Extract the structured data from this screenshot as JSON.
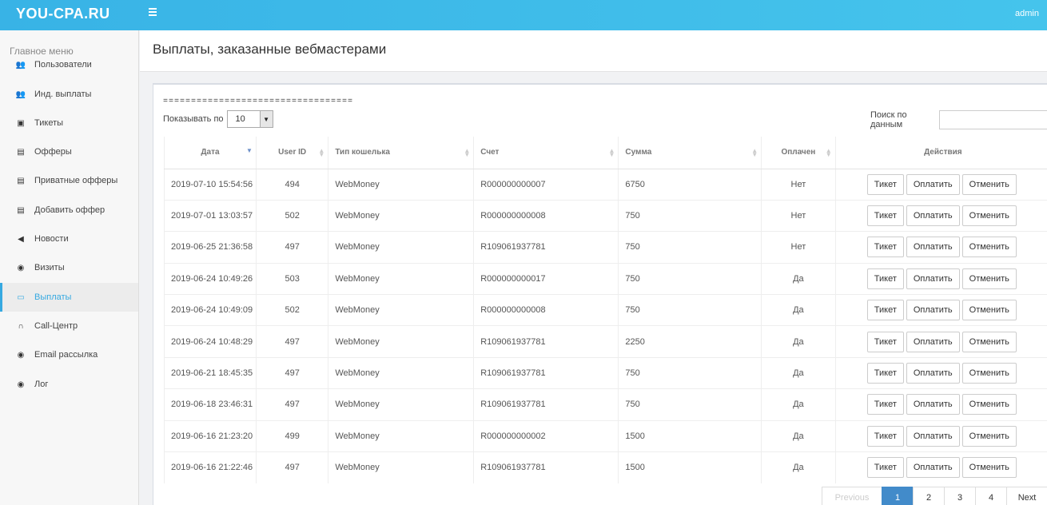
{
  "app": {
    "logo": "YOU-CPA.RU",
    "user": "admin"
  },
  "sidebar": {
    "title": "Главное меню",
    "items": [
      {
        "label": "Пользователи",
        "icon": "users-icon",
        "glyph": "👥"
      },
      {
        "label": "Инд. выплаты",
        "icon": "users-icon",
        "glyph": "👥"
      },
      {
        "label": "Тикеты",
        "icon": "chart-icon",
        "glyph": "▣"
      },
      {
        "label": "Офферы",
        "icon": "list-icon",
        "glyph": "▤"
      },
      {
        "label": "Приватные офферы",
        "icon": "list-icon",
        "glyph": "▤"
      },
      {
        "label": "Добавить оффер",
        "icon": "list-icon",
        "glyph": "▤"
      },
      {
        "label": "Новости",
        "icon": "bullhorn-icon",
        "glyph": "◀"
      },
      {
        "label": "Визиты",
        "icon": "eye-icon",
        "glyph": "◉"
      },
      {
        "label": "Выплаты",
        "icon": "money-icon",
        "glyph": "▭"
      },
      {
        "label": "Call-Центр",
        "icon": "headphones-icon",
        "glyph": "∩"
      },
      {
        "label": "Email рассылка",
        "icon": "eye-icon",
        "glyph": "◉"
      },
      {
        "label": "Лог",
        "icon": "eye-icon",
        "glyph": "◉"
      }
    ],
    "active_index": 8
  },
  "page": {
    "title": "Выплаты, заказанные вебмастерами"
  },
  "controls": {
    "dashes": "==================================",
    "length_label": "Показывать по",
    "length_value": "10",
    "search_label": "Поиск по данным",
    "search_value": ""
  },
  "table": {
    "columns": [
      "Дата",
      "User ID",
      "Тип кошелька",
      "Счет",
      "Сумма",
      "Оплачен",
      "Действия"
    ],
    "actions": {
      "ticket": "Тикет",
      "pay": "Оплатить",
      "cancel": "Отменить"
    },
    "rows": [
      {
        "date": "2019-07-10 15:54:56",
        "user_id": "494",
        "wallet": "WebMoney",
        "account": "R000000000007",
        "amount": "6750",
        "paid": "Нет"
      },
      {
        "date": "2019-07-01 13:03:57",
        "user_id": "502",
        "wallet": "WebMoney",
        "account": "R000000000008",
        "amount": "750",
        "paid": "Нет"
      },
      {
        "date": "2019-06-25 21:36:58",
        "user_id": "497",
        "wallet": "WebMoney",
        "account": "R109061937781",
        "amount": "750",
        "paid": "Нет"
      },
      {
        "date": "2019-06-24 10:49:26",
        "user_id": "503",
        "wallet": "WebMoney",
        "account": "R000000000017",
        "amount": "750",
        "paid": "Да"
      },
      {
        "date": "2019-06-24 10:49:09",
        "user_id": "502",
        "wallet": "WebMoney",
        "account": "R000000000008",
        "amount": "750",
        "paid": "Да"
      },
      {
        "date": "2019-06-24 10:48:29",
        "user_id": "497",
        "wallet": "WebMoney",
        "account": "R109061937781",
        "amount": "2250",
        "paid": "Да"
      },
      {
        "date": "2019-06-21 18:45:35",
        "user_id": "497",
        "wallet": "WebMoney",
        "account": "R109061937781",
        "amount": "750",
        "paid": "Да"
      },
      {
        "date": "2019-06-18 23:46:31",
        "user_id": "497",
        "wallet": "WebMoney",
        "account": "R109061937781",
        "amount": "750",
        "paid": "Да"
      },
      {
        "date": "2019-06-16 21:23:20",
        "user_id": "499",
        "wallet": "WebMoney",
        "account": "R000000000002",
        "amount": "1500",
        "paid": "Да"
      },
      {
        "date": "2019-06-16 21:22:46",
        "user_id": "497",
        "wallet": "WebMoney",
        "account": "R109061937781",
        "amount": "1500",
        "paid": "Да"
      }
    ]
  },
  "pagination": {
    "previous": "Previous",
    "pages": [
      "1",
      "2",
      "3",
      "4"
    ],
    "current": "1",
    "next": "Next"
  },
  "colors": {
    "topbar": "#38b3e6",
    "accent": "#36a9e1",
    "page_active": "#428bca"
  }
}
